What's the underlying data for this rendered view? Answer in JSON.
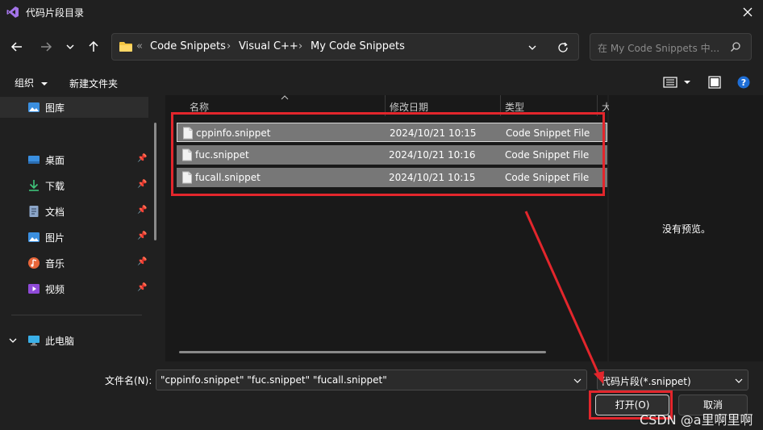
{
  "window": {
    "title": "代码片段目录",
    "icon": "visual-studio-icon",
    "close_icon": "close-icon"
  },
  "nav": {
    "back_icon": "arrow-left-icon",
    "forward_icon": "arrow-right-icon",
    "recent_icon": "chevron-down-icon",
    "up_icon": "arrow-up-icon"
  },
  "address": {
    "overflow": "«",
    "crumbs": [
      "Code Snippets",
      "Visual C++",
      "My Code Snippets"
    ],
    "separator": "›",
    "refresh_icon": "refresh-icon"
  },
  "search": {
    "placeholder": "在 My Code Snippets 中...",
    "icon": "search-icon"
  },
  "toolbar": {
    "organize": "组织",
    "new_folder": "新建文件夹"
  },
  "sidebar": {
    "gallery": "图库",
    "items": [
      {
        "label": "桌面",
        "icon": "desktop-icon"
      },
      {
        "label": "下载",
        "icon": "download-icon"
      },
      {
        "label": "文档",
        "icon": "document-icon"
      },
      {
        "label": "图片",
        "icon": "picture-icon"
      },
      {
        "label": "音乐",
        "icon": "music-icon"
      },
      {
        "label": "视频",
        "icon": "video-icon"
      }
    ],
    "this_pc": "此电脑"
  },
  "filelist": {
    "columns": [
      "名称",
      "修改日期",
      "类型",
      "大"
    ],
    "rows": [
      {
        "name": "cppinfo.snippet",
        "date": "2024/10/21 10:15",
        "type": "Code Snippet File"
      },
      {
        "name": "fuc.snippet",
        "date": "2024/10/21 10:16",
        "type": "Code Snippet File"
      },
      {
        "name": "fucall.snippet",
        "date": "2024/10/21 10:15",
        "type": "Code Snippet File"
      }
    ]
  },
  "preview": {
    "empty_text": "没有预览。"
  },
  "bottom": {
    "filename_label": "文件名(N):",
    "filename_value": "\"cppinfo.snippet\" \"fuc.snippet\" \"fucall.snippet\"",
    "filetype_value": "代码片段(*.snippet)",
    "open_label": "打开(O)",
    "cancel_label": "取消"
  },
  "watermark": "CSDN @a里啊里啊",
  "colors": {
    "annotation": "#e3262c",
    "background": "#202020",
    "selection": "#777777"
  }
}
